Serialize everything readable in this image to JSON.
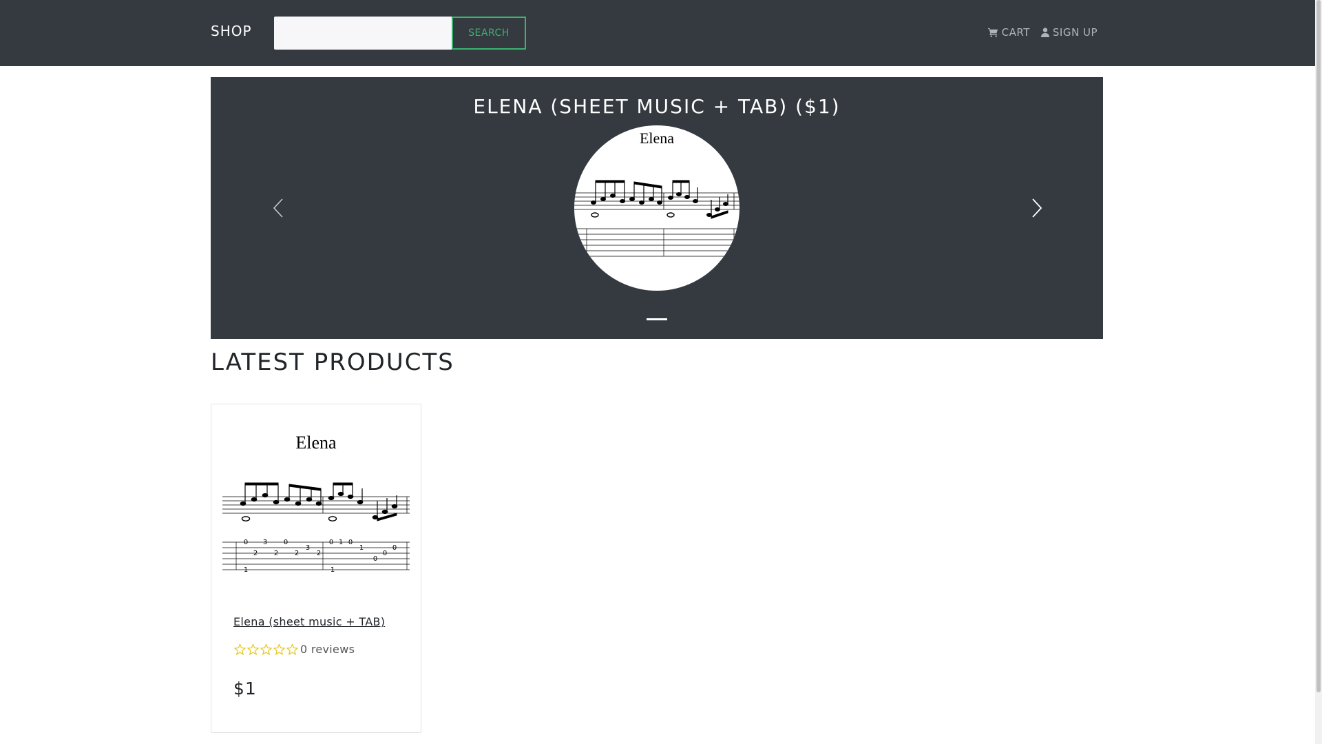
{
  "navbar": {
    "brand": "SHOP",
    "search_placeholder": "",
    "search_button": "SEARCH",
    "cart_label": "CART",
    "signup_label": "SIGN UP"
  },
  "carousel": {
    "title": "ELENA (SHEET MUSIC + TAB) ($1)",
    "image_caption": "Elena",
    "active_slide": 1,
    "total_slides": 1
  },
  "latest_products": {
    "heading": "LATEST PRODUCTS",
    "products": [
      {
        "image_caption": "Elena",
        "name": "Elena (sheet music + TAB)",
        "rating": 0,
        "max_rating": 5,
        "reviews": "0 reviews",
        "price": "$1"
      }
    ]
  },
  "sheet_music": {
    "tab_top_row": [
      "0",
      "3",
      "0",
      "0",
      "1",
      "0",
      "0"
    ],
    "tab_mid_row": [
      "2",
      "2",
      "2",
      "3",
      "2",
      "1",
      "0"
    ],
    "tab_bottom_row": [
      "1",
      "1",
      "0"
    ]
  },
  "colors": {
    "navbar_bg": "#343a40",
    "accent_green": "#3cb371",
    "star_yellow": "#e6c619"
  },
  "icons": {
    "cart": "cart-icon",
    "user": "user-icon",
    "prev": "chevron-left-icon",
    "next": "chevron-right-icon",
    "star": "star-outline-icon"
  }
}
